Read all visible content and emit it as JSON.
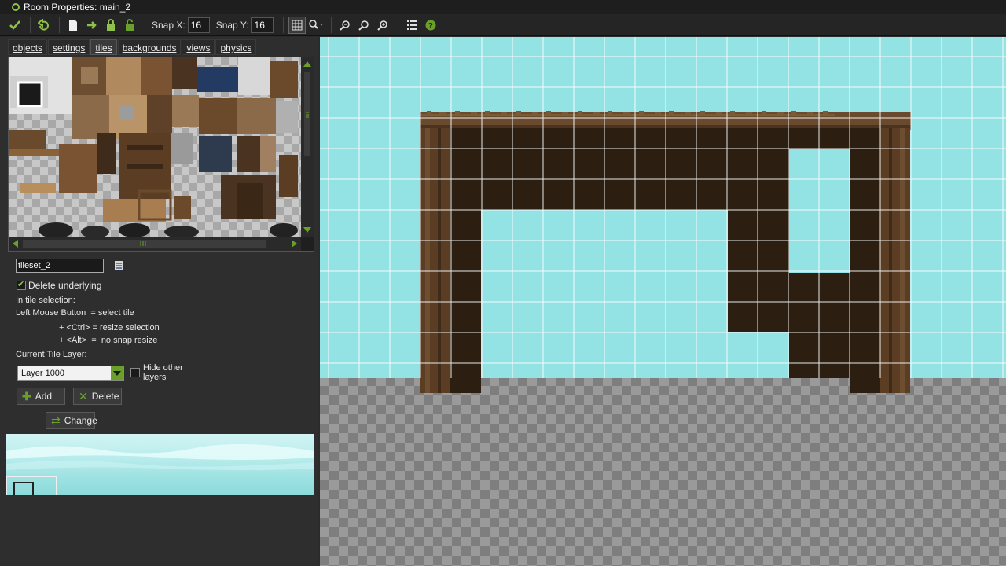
{
  "window": {
    "title": "Room Properties: main_2"
  },
  "toolbar": {
    "snap_x_label": "Snap X:",
    "snap_x_value": "16",
    "snap_y_label": "Snap Y:",
    "snap_y_value": "16"
  },
  "tabs": [
    {
      "label": "objects"
    },
    {
      "label": "settings"
    },
    {
      "label": "tiles",
      "active": true
    },
    {
      "label": "backgrounds"
    },
    {
      "label": "views"
    },
    {
      "label": "physics"
    }
  ],
  "tiles_panel": {
    "tileset_name": "tileset_2",
    "delete_underlying_label": "Delete underlying",
    "delete_underlying_checked": true,
    "help_title": "In tile selection:",
    "help_line1": "Left Mouse Button  = select tile",
    "help_line2": "+ <Ctrl> = resize selection",
    "help_line3": "+ <Alt>  =  no snap resize",
    "current_layer_label": "Current Tile Layer:",
    "current_layer_value": "Layer 1000",
    "hide_other_label_1": "Hide other",
    "hide_other_label_2": "layers",
    "hide_other_checked": false,
    "add_label": "Add",
    "delete_label": "Delete",
    "change_label": "Change"
  },
  "colors": {
    "sky": "#93e2e4",
    "wall_dark": "#2c1f11",
    "wood": "#5a3d22",
    "grid": "#ffffff",
    "accent_green": "#6aa02a"
  }
}
